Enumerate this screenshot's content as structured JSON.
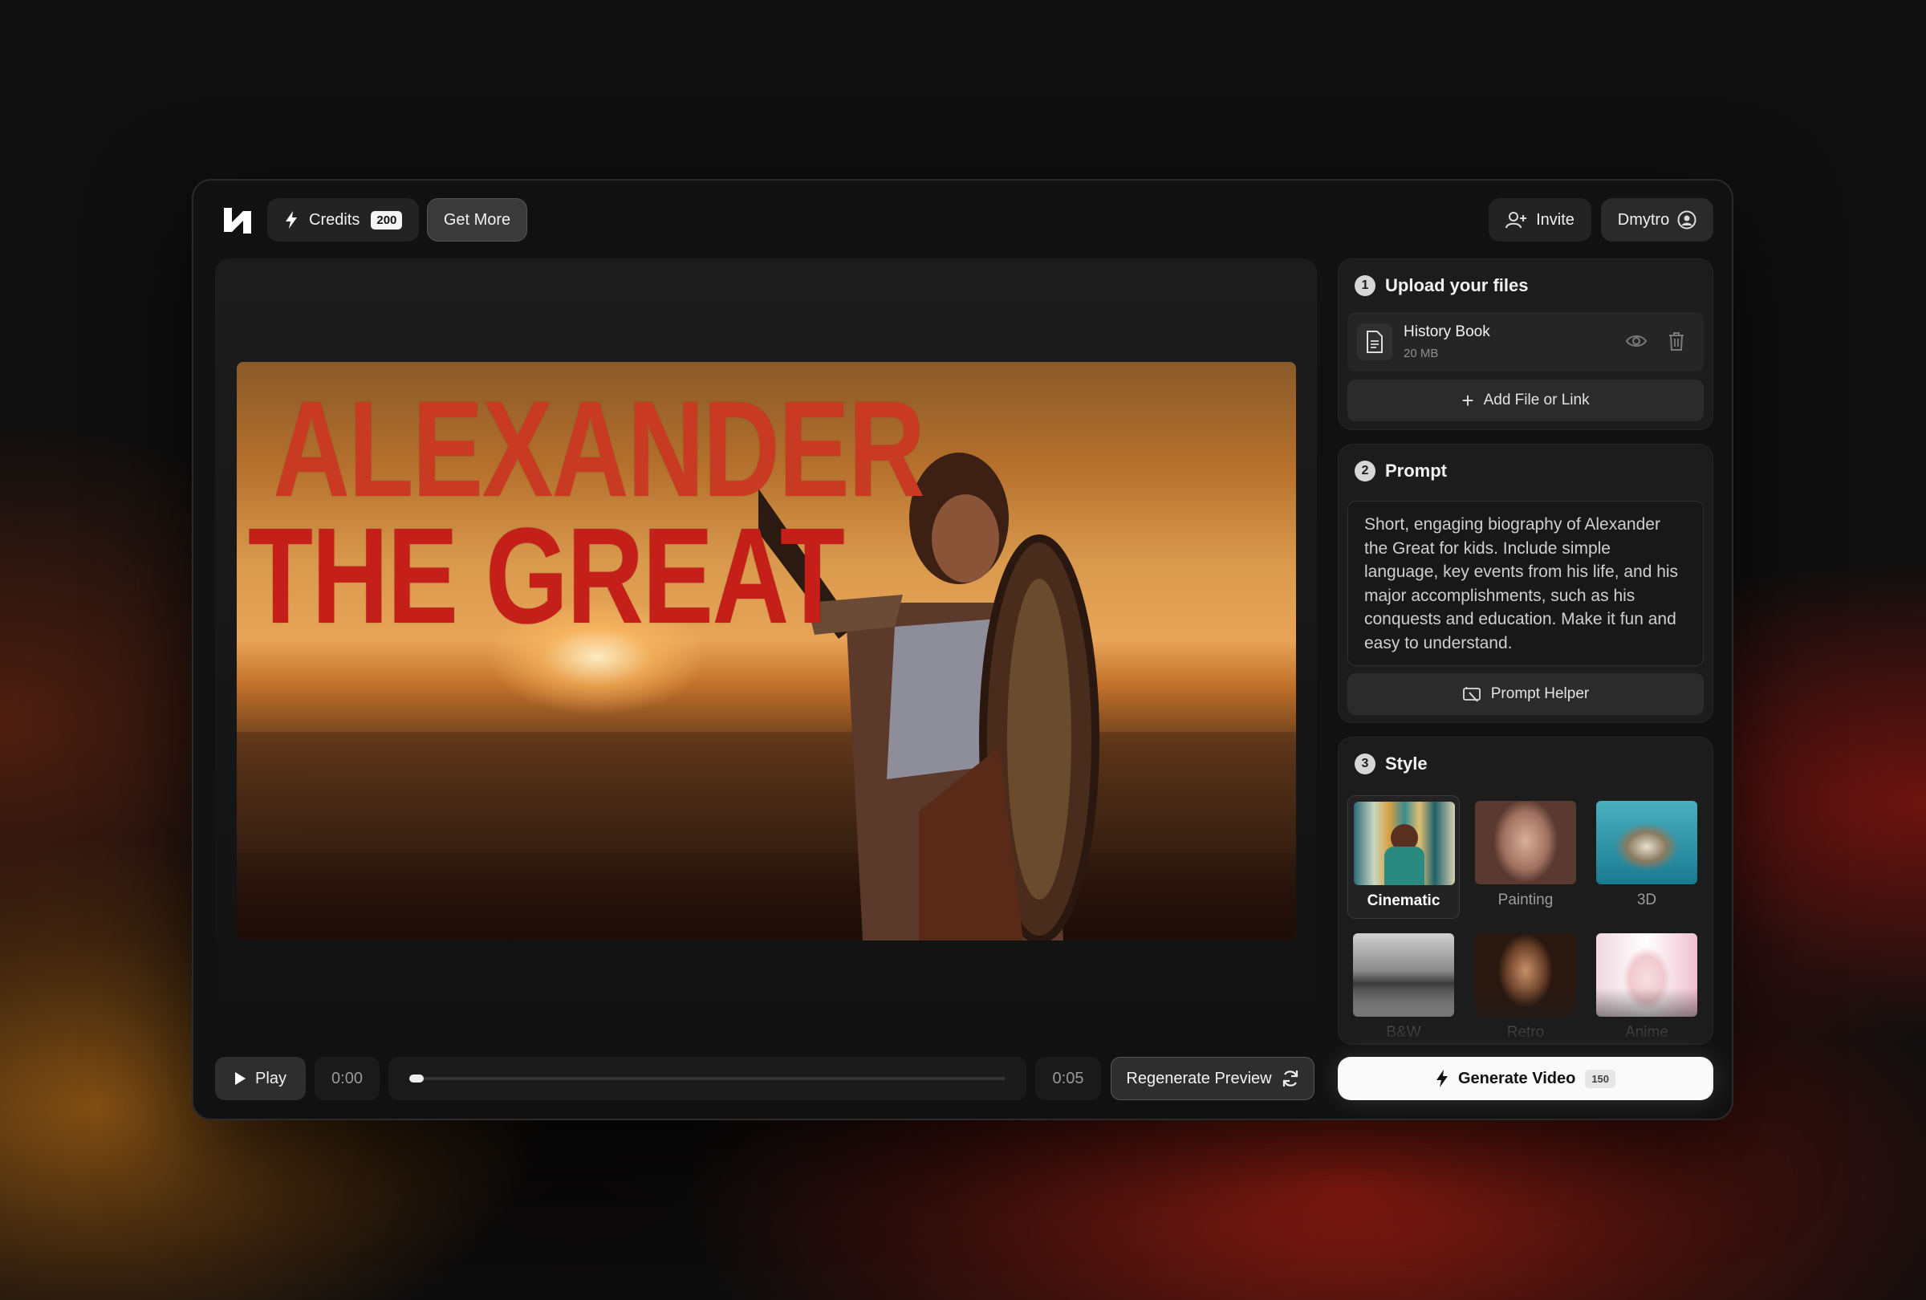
{
  "header": {
    "credits_label": "Credits",
    "credits_count": "200",
    "get_more_label": "Get More",
    "invite_label": "Invite",
    "user_name": "Dmytro"
  },
  "preview": {
    "title_line1": "ALEXANDER",
    "title_line2": "THE GREAT"
  },
  "player": {
    "play_label": "Play",
    "time_current": "0:00",
    "time_total": "0:05",
    "progress": 0.0,
    "regenerate_label": "Regenerate Preview"
  },
  "upload": {
    "step": "1",
    "title": "Upload your files",
    "file_name": "History Book",
    "file_size": "20 MB",
    "add_label": "Add File or Link"
  },
  "prompt": {
    "step": "2",
    "title": "Prompt",
    "text": "Short, engaging biography of Alexander the Great for kids. Include simple language, key events from his life, and his major accomplishments, such as his conquests and education. Make it fun and easy to understand.",
    "helper_label": "Prompt Helper"
  },
  "style": {
    "step": "3",
    "title": "Style",
    "selected": "Cinematic",
    "options": [
      {
        "label": "Cinematic"
      },
      {
        "label": "Painting"
      },
      {
        "label": "3D"
      },
      {
        "label": "B&W"
      },
      {
        "label": "Retro"
      },
      {
        "label": "Anime"
      }
    ]
  },
  "generate": {
    "label": "Generate Video",
    "cost": "150"
  },
  "colors": {
    "accent_title_red": "#c42019",
    "button_light": "#fafafa"
  }
}
